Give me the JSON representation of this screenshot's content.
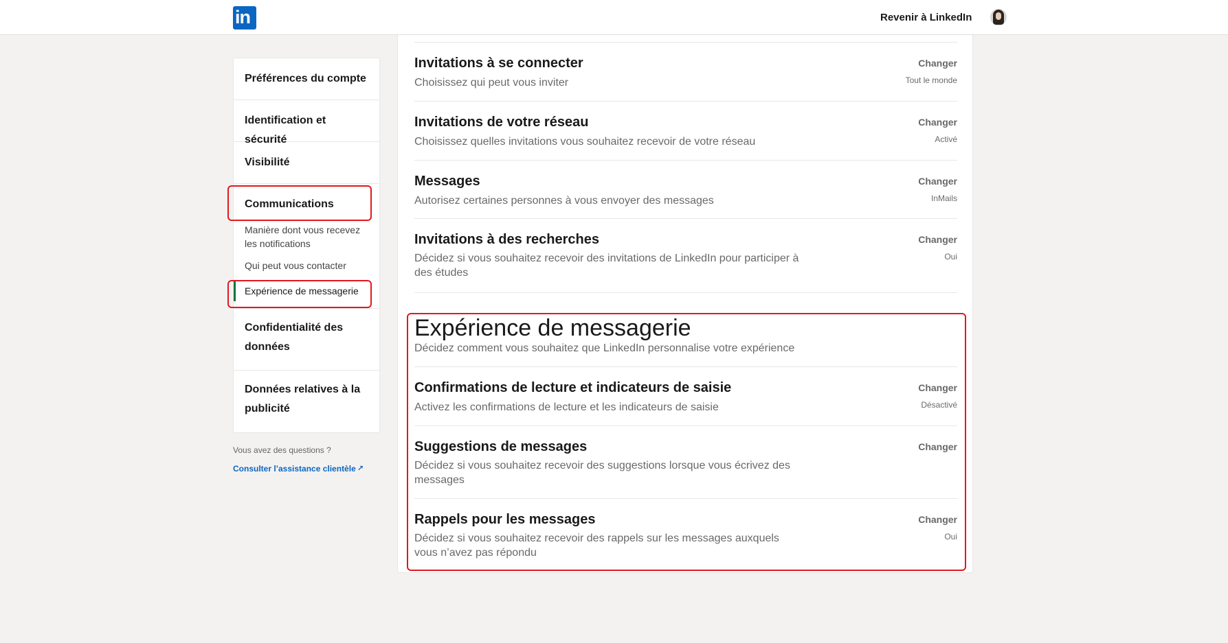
{
  "header": {
    "logo_text": "in",
    "back_link": "Revenir à LinkedIn"
  },
  "sidebar": {
    "items": [
      {
        "label": "Préférences du compte"
      },
      {
        "label": "Identification et sécurité"
      },
      {
        "label": "Visibilité"
      },
      {
        "label": "Communications"
      },
      {
        "label": "Confidentialité des données"
      },
      {
        "label": "Données relatives à la publicité"
      }
    ],
    "sub_items": [
      {
        "label": "Manière dont vous recevez les notifications"
      },
      {
        "label": "Qui peut vous contacter"
      },
      {
        "label": "Expérience de messagerie"
      }
    ],
    "help_question": "Vous avez des questions ?",
    "help_link": "Consulter l’assistance clientèle"
  },
  "main": {
    "rows_top": [
      {
        "title": "Invitations à se connecter",
        "desc": "Choisissez qui peut vous inviter",
        "action": "Changer",
        "value": "Tout le monde"
      },
      {
        "title": "Invitations de votre réseau",
        "desc": "Choisissez quelles invitations vous souhaitez recevoir de votre réseau",
        "action": "Changer",
        "value": "Activé"
      },
      {
        "title": "Messages",
        "desc": "Autorisez certaines personnes à vous envoyer des messages",
        "action": "Changer",
        "value": "InMails"
      },
      {
        "title": "Invitations à des recherches",
        "desc": "Décidez si vous souhaitez recevoir des invitations de LinkedIn pour participer à des études",
        "action": "Changer",
        "value": "Oui"
      }
    ],
    "section": {
      "title": "Expérience de messagerie",
      "desc": "Décidez comment vous souhaitez que LinkedIn personnalise votre expérience"
    },
    "rows_section": [
      {
        "title": "Confirmations de lecture et indicateurs de saisie",
        "desc": "Activez les confirmations de lecture et les indicateurs de saisie",
        "action": "Changer",
        "value": "Désactivé"
      },
      {
        "title": "Suggestions de messages",
        "desc": "Décidez si vous souhaitez recevoir des suggestions lorsque vous écrivez des messages",
        "action": "Changer",
        "value": ""
      },
      {
        "title": "Rappels pour les messages",
        "desc": "Décidez si vous souhaitez recevoir des rappels sur les messages auxquels vous n’avez pas répondu",
        "action": "Changer",
        "value": "Oui"
      }
    ]
  },
  "colors": {
    "brand": "#0a66c2",
    "active_indicator": "#057642",
    "highlight": "#e0181f",
    "background": "#f3f2f0"
  }
}
